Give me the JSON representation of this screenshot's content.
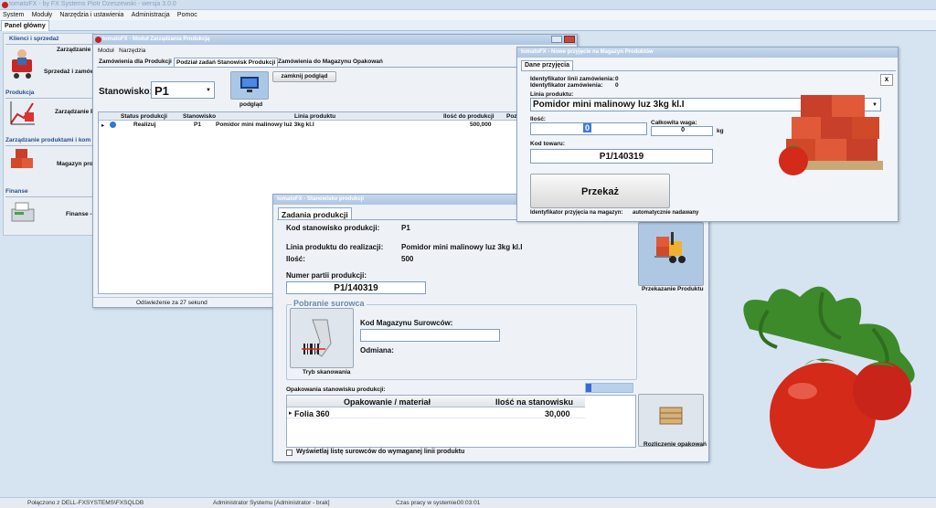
{
  "app": {
    "title": "tomatoFX - by FX Systems Piotr Dzeszewski - wersja 3.0.0",
    "menu": [
      "System",
      "Moduły",
      "Narzędzia i ustawienia",
      "Administracja",
      "Pomoc"
    ],
    "main_tab": "Panel główny"
  },
  "sidebar": {
    "sections": [
      {
        "title": "Klienci i sprzedaż",
        "items": [
          "Zarządzanie K",
          "Sprzedaż i zamów"
        ]
      },
      {
        "title": "Produkcja",
        "items": [
          "Zarządzanie P"
        ]
      },
      {
        "title": "Zarządzanie produktami i kom",
        "items": [
          "Magazyn pro"
        ]
      },
      {
        "title": "Finanse",
        "items": [
          "Finanse -"
        ]
      }
    ]
  },
  "prod_window": {
    "title": "tomatoFX - Moduł Zarządzania Produkcją",
    "menu": [
      "Moduł",
      "Narzędzia"
    ],
    "tabs": [
      "Zamówienia dla Produkcji",
      "Podział zadań Stanowisk Produkcji",
      "Zamówienia do Magazynu Opakowań"
    ],
    "station_label": "Stanowisko:",
    "station_value": "P1",
    "preview_label": "podgląd",
    "close_preview": "zamknij podgląd",
    "columns": [
      "Status produkcji",
      "Stanowisko",
      "Linia produktu",
      "Ilość do produkcji",
      "Pozo"
    ],
    "rows": [
      {
        "status": "Realizuj",
        "station": "P1",
        "line": "Pomidor mini malinowy luz 3kg kl.I",
        "qty": "500,000"
      }
    ],
    "status": "Odświeżenie za 27 sekund"
  },
  "station_window": {
    "title": "tomatoFX - Stanowisko produkcji",
    "tab": "Zadania produkcji",
    "code_label": "Kod stanowisko produkcji:",
    "code_value": "P1",
    "line_label": "Linia produktu do realizacji:",
    "line_value": "Pomidor mini malinowy luz 3kg kl.I",
    "qty_label": "Ilość:",
    "qty_value": "500",
    "batch_label": "Numer partii produkcji:",
    "batch_value": "P1/140319",
    "handover_label": "Przekazanie Produktu",
    "raw_group": "Pobranie surowca",
    "scan_label": "Tryb skanowania",
    "raw_code_label": "Kod Magazynu Surowców:",
    "raw_code_value": "",
    "weighing_label": "Odmiana:",
    "packaging_caption": "Opakowania stanowisku produkcji:",
    "pack_columns": [
      "Opakowanie / materiał",
      "Ilość na stanowisku"
    ],
    "pack_rows": [
      {
        "name": "Folia 360",
        "qty": "30,000"
      }
    ],
    "pack_button": "Rozliczenie opakowań",
    "checkbox_label": "Wyświetlaj listę surowców do wymaganej linii produktu",
    "progress": 0.12
  },
  "receipt_window": {
    "title": "tomatoFX - Nowe przyjęcie na Magazyn Produktów",
    "tab": "Dane przyjęcia",
    "id_line_label": "Identyfikator linii zamówienia:",
    "id_line_value": "0",
    "id_order_label": "Identyfikator zamówienia:",
    "id_order_value": "0",
    "product_line_label": "Linia produktu:",
    "product_line_value": "Pomidor mini malinowy luz 3kg kl.I",
    "qty_label": "Ilość:",
    "qty_value": "0",
    "total_weight_label": "Całkowita waga:",
    "total_weight_value": "0",
    "weight_unit": "kg",
    "code_label": "Kod towaru:",
    "code_value": "P1/140319",
    "submit": "Przekaż",
    "receipt_id_label": "Identyfikator przyjęcia na magazyn:",
    "receipt_id_value": "automatycznie nadawany",
    "close": "x"
  },
  "statusbar": {
    "connection": "Połączono z DELL-FXSYSTEMS\\FXSQLDB",
    "user": "Administrator Systemu [Administrator - brak]",
    "time_label": "Czas pracy w systemie:",
    "time_value": "00:03:01"
  },
  "colors": {
    "accent": "#2a4f8a",
    "tomato": "#d42a1a",
    "leaf": "#3d8a2a"
  }
}
